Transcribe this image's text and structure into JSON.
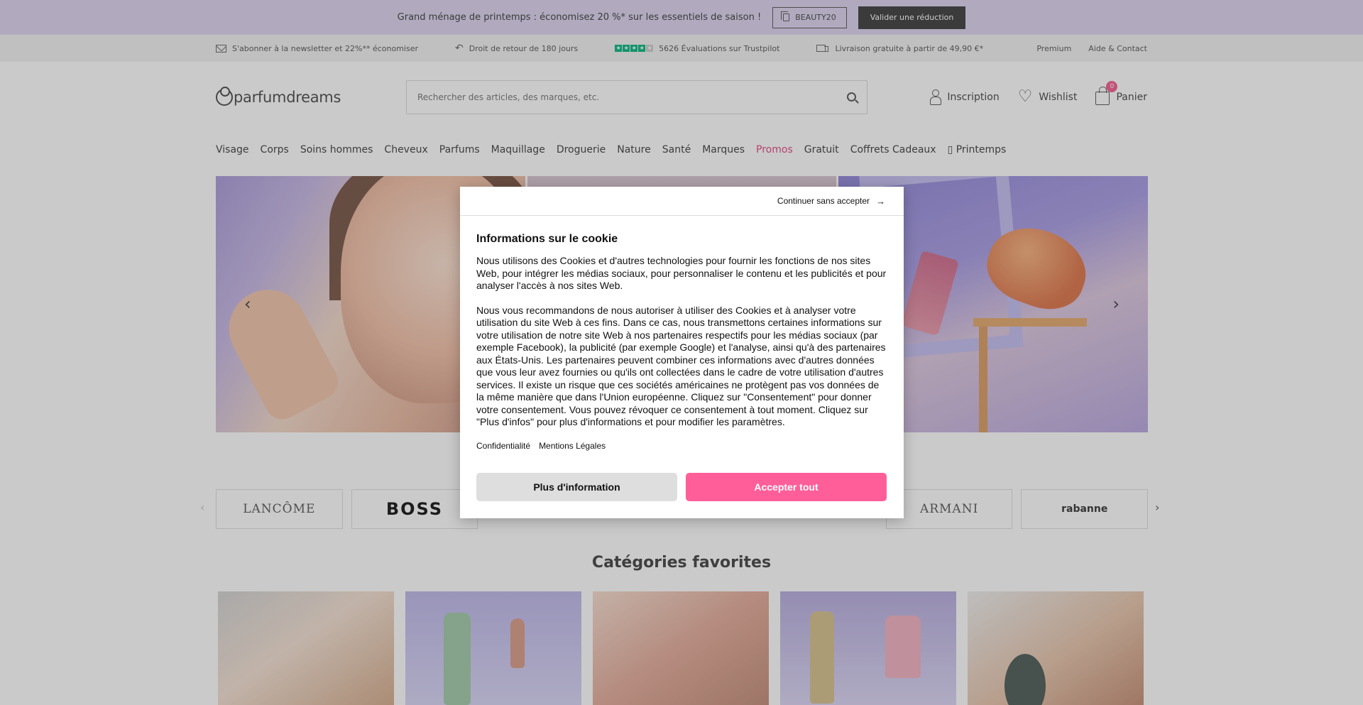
{
  "promo": {
    "text": "Grand ménage de printemps : économisez 20 %* sur les essentiels de saison !",
    "coupon_code": "BEAUTY20",
    "validate_label": "Valider une réduction"
  },
  "usp": {
    "newsletter": "S'abonner à la newsletter et 22%** économiser",
    "returns": "Droit de retour de 180 jours",
    "reviews": "5626 Évaluations sur Trustpilot",
    "shipping": "Livraison gratuite à partir de 49,90 €*",
    "premium": "Premium",
    "help": "Aide & Contact"
  },
  "header": {
    "logo": "parfumdreams",
    "search_placeholder": "Rechercher des articles, des marques, etc.",
    "signup": "Inscription",
    "wishlist": "Wishlist",
    "cart": "Panier",
    "cart_count": "0"
  },
  "nav": {
    "items": [
      "Visage",
      "Corps",
      "Soins hommes",
      "Cheveux",
      "Parfums",
      "Maquillage",
      "Droguerie",
      "Nature",
      "Santé",
      "Marques",
      "Promos",
      "Gratuit",
      "Coffrets Cadeaux",
      "▯ Printemps"
    ]
  },
  "brands": {
    "items": [
      "LANCÔME",
      "BOSS",
      "ARMANI",
      "rabanne"
    ]
  },
  "categories": {
    "title": "Catégories favorites"
  },
  "cookie": {
    "continue": "Continuer sans accepter",
    "title": "Informations sur le cookie",
    "paragraph1": "Nous utilisons des Cookies et d'autres technologies pour fournir les fonctions de nos sites Web, pour intégrer les médias sociaux, pour personnaliser le contenu et les publicités et pour analyser l'accès à nos sites Web.",
    "paragraph2": "Nous vous recommandons de nous autoriser à utiliser des Cookies et à analyser votre utilisation du site Web à ces fins. Dans ce cas, nous transmettons certaines informations sur votre utilisation de notre site Web à nos partenaires respectifs pour les médias sociaux (par exemple Facebook), la publicité (par exemple Google) et l'analyse, ainsi qu'à des partenaires aux États-Unis. Les partenaires peuvent combiner ces informations avec d'autres données que vous leur avez fournies ou qu'ils ont collectées dans le cadre de votre utilisation d'autres services. Il existe un risque que ces sociétés américaines ne protègent pas vos données de la même manière que dans l'Union européenne. Cliquez sur \"Consentement\" pour donner votre consentement. Vous pouvez révoquer ce consentement à tout moment. Cliquez sur \"Plus d'infos\" pour plus d'informations et pour modifier les paramètres.",
    "privacy": "Confidentialité",
    "legal": "Mentions Légales",
    "more_info": "Plus d'information",
    "accept_all": "Accepter tout"
  },
  "colors": {
    "promo_background": "#ddd3f0",
    "accent_pink": "#ff5e98",
    "promo_nav": "#e04680",
    "trustpilot": "#00b67a"
  },
  "icons": [
    "copy-icon",
    "mail-icon",
    "return-icon",
    "trustpilot-stars-icon",
    "truck-icon",
    "search-icon",
    "user-icon",
    "heart-icon",
    "shopping-bag-icon",
    "chevron-left-icon",
    "chevron-right-icon",
    "arrow-right-icon"
  ]
}
